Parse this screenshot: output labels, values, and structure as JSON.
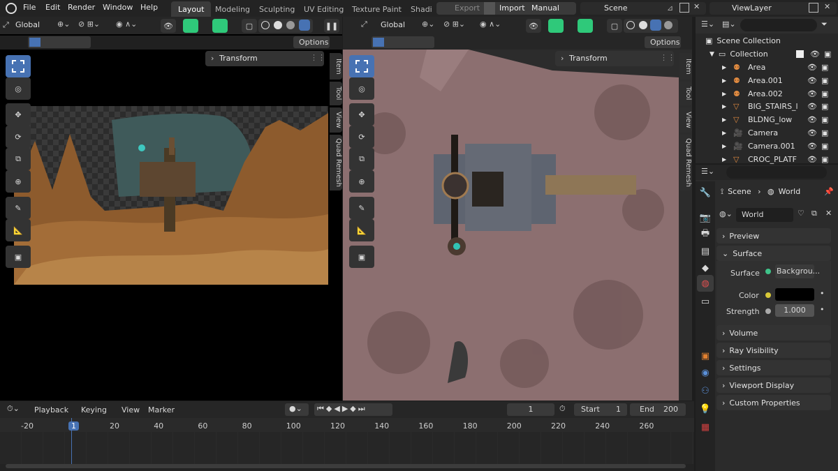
{
  "menu": {
    "file": "File",
    "edit": "Edit",
    "render": "Render",
    "window": "Window",
    "help": "Help"
  },
  "workspaces": [
    "Layout",
    "Modeling",
    "Sculpting",
    "UV Editing",
    "Texture Paint",
    "Shadi"
  ],
  "topbar": {
    "export": "Export",
    "import": "Import",
    "manual": "Manual",
    "scene": "Scene",
    "viewlayer": "ViewLayer"
  },
  "viewport_left": {
    "transform_orientation": "Global",
    "options": "Options",
    "transform_panel": "Transform",
    "tabs": [
      "Item",
      "Tool",
      "View",
      "Quad Remesh"
    ]
  },
  "viewport_right": {
    "transform_orientation": "Global",
    "options": "Options",
    "transform_panel": "Transform",
    "tabs": [
      "Item",
      "Tool",
      "View",
      "Quad Remesh"
    ]
  },
  "outliner": {
    "scene_collection": "Scene Collection",
    "collection": "Collection",
    "items": [
      "Area",
      "Area.001",
      "Area.002",
      "BIG_STAIRS_l",
      "BLDNG_low",
      "Camera",
      "Camera.001",
      "CROC_PLATF"
    ]
  },
  "properties": {
    "breadcrumb_scene": "Scene",
    "breadcrumb_world": "World",
    "world_name": "World",
    "panels": {
      "preview": "Preview",
      "surface": "Surface",
      "volume": "Volume",
      "ray_visibility": "Ray Visibility",
      "settings": "Settings",
      "viewport_display": "Viewport Display",
      "custom_properties": "Custom Properties"
    },
    "surface_label": "Surface",
    "surface_value": "Backgrou...",
    "color_label": "Color",
    "strength_label": "Strength",
    "strength_value": "1.000"
  },
  "timeline": {
    "playback": "Playback",
    "keying": "Keying",
    "view": "View",
    "marker": "Marker",
    "current_frame": "1",
    "start_label": "Start",
    "start_value": "1",
    "end_label": "End",
    "end_value": "200",
    "ruler": [
      "-20",
      "1",
      "20",
      "40",
      "60",
      "80",
      "100",
      "120",
      "140",
      "160",
      "180",
      "200",
      "220",
      "240",
      "260"
    ]
  },
  "colors": {
    "accent_blue": "#4772b3",
    "accent_green": "#2fc97a",
    "background": "#1d1d1d"
  }
}
